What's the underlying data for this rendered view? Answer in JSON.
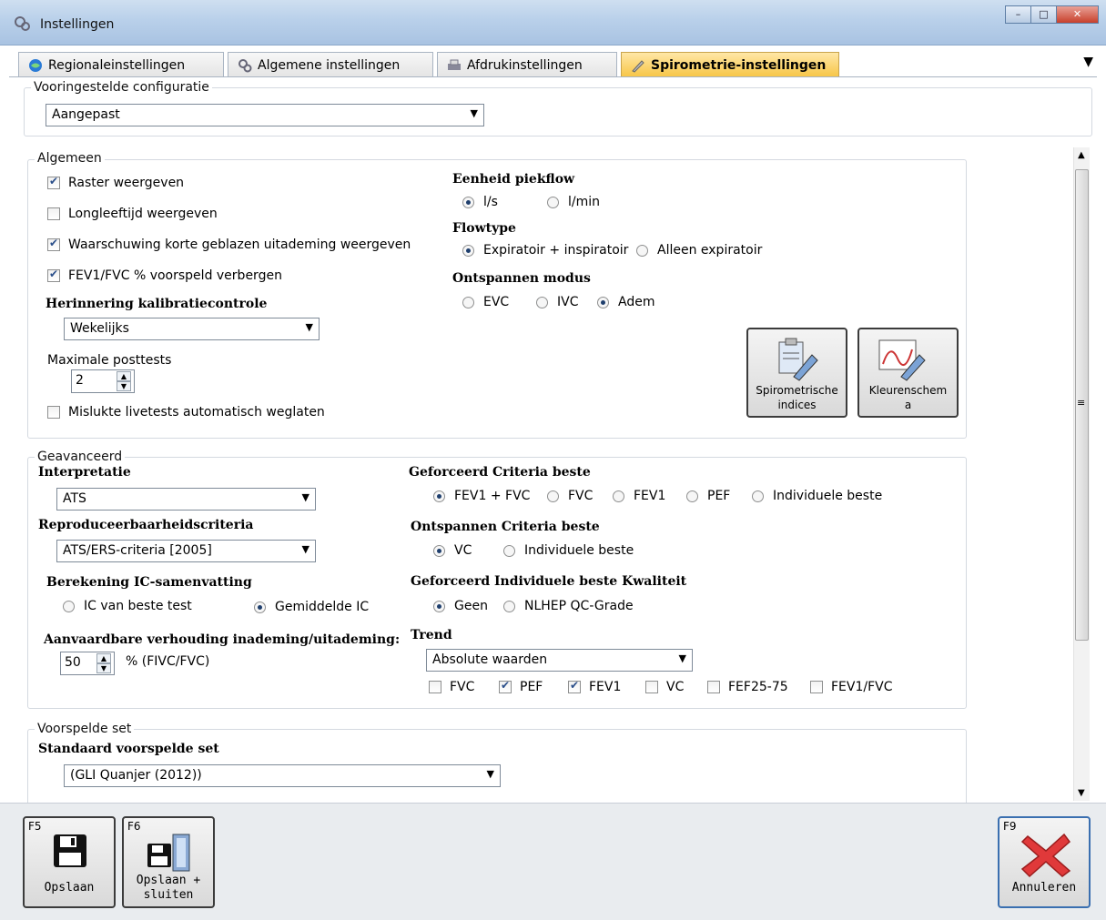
{
  "window": {
    "title": "Instellingen",
    "minimize": "–",
    "maximize": "□",
    "close": "✕"
  },
  "tabs": [
    {
      "label": "Regionaleinstellingen"
    },
    {
      "label": "Algemene instellingen"
    },
    {
      "label": "Afdrukinstellingen"
    },
    {
      "label": "Spirometrie-instellingen"
    }
  ],
  "tab_menu": "▼",
  "preset": {
    "legend": "Vooringestelde configuratie",
    "value": "Aangepast"
  },
  "general": {
    "legend": "Algemeen",
    "checkboxes": [
      {
        "label": "Raster weergeven",
        "checked": true
      },
      {
        "label": "Longleeftijd weergeven",
        "checked": false
      },
      {
        "label": "Waarschuwing korte geblazen uitademing weergeven",
        "checked": true
      },
      {
        "label": "FEV1/FVC % voorspeld verbergen",
        "checked": true
      }
    ],
    "calibration_title": "Herinnering kalibratiecontrole",
    "calibration_value": "Wekelijks",
    "max_posttests_label": "Maximale posttests",
    "max_posttests_value": "2",
    "auto_omit_label": "Mislukte livetests automatisch weglaten",
    "peakflow_title": "Eenheid piekflow",
    "peakflow_opts": [
      "l/s",
      "l/min"
    ],
    "flowtype_title": "Flowtype",
    "flowtype_opts": [
      "Expiratoir + inspiratoir",
      "Alleen expiratoir"
    ],
    "relax_title": "Ontspannen modus",
    "relax_opts": [
      "EVC",
      "IVC",
      "Adem"
    ],
    "btn_indices": "Spirometrische indices",
    "btn_colors": "Kleurenschema"
  },
  "advanced": {
    "legend": "Geavanceerd",
    "interp_title": "Interpretatie",
    "interp_value": "ATS",
    "repro_title": "Reproduceerbaarheidscriteria",
    "repro_value": "ATS/ERS-criteria [2005]",
    "ic_title": "Berekening IC-samenvatting",
    "ic_opts": [
      "IC van beste test",
      "Gemiddelde IC"
    ],
    "ratio_title": "Aanvaardbare verhouding inademing/uitademing:",
    "ratio_value": "50",
    "ratio_unit": "% (FIVC/FVC)",
    "forced_title": "Geforceerd Criteria beste",
    "forced_opts": [
      "FEV1 + FVC",
      "FVC",
      "FEV1",
      "PEF",
      "Individuele beste"
    ],
    "relaxed_title": "Ontspannen Criteria beste",
    "relaxed_opts": [
      "VC",
      "Individuele beste"
    ],
    "quality_title": "Geforceerd Individuele beste Kwaliteit",
    "quality_opts": [
      "Geen",
      "NLHEP QC-Grade"
    ],
    "trend_title": "Trend",
    "trend_value": "Absolute waarden",
    "trend_checks": [
      {
        "label": "FVC",
        "checked": false
      },
      {
        "label": "PEF",
        "checked": true
      },
      {
        "label": "FEV1",
        "checked": true
      },
      {
        "label": "VC",
        "checked": false
      },
      {
        "label": "FEF25-75",
        "checked": false
      },
      {
        "label": "FEV1/FVC",
        "checked": false
      }
    ]
  },
  "predicted": {
    "legend": "Voorspelde set",
    "title": "Standaard voorspelde set",
    "value": "(GLI Quanjer (2012))"
  },
  "footer": {
    "save_key": "F5",
    "save_label": "Opslaan",
    "saveclose_key": "F6",
    "saveclose_label": "Opslaan + sluiten",
    "cancel_key": "F9",
    "cancel_label": "Annuleren"
  }
}
